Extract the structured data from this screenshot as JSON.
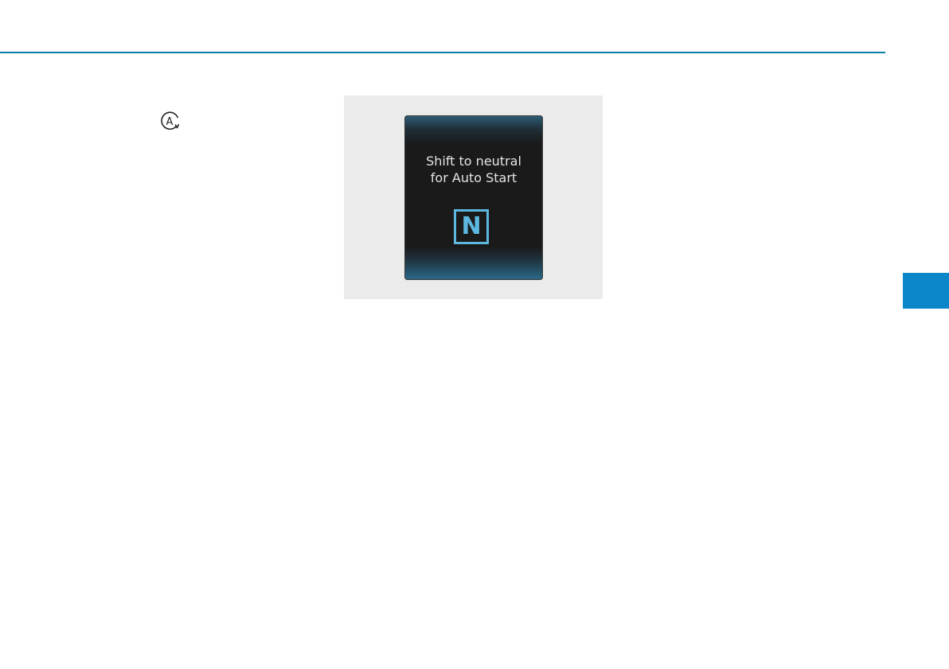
{
  "figure": {
    "display": {
      "message_line1": "Shift to neutral",
      "message_line2": "for Auto Start",
      "gear_indicator": "N"
    }
  },
  "icons": {
    "auto_stop": "auto-stop-indicator-icon"
  },
  "colors": {
    "accent": "#0a7fa8",
    "chapter_tab": "#0b86c8",
    "indicator": "#5cb8e0",
    "display_background": "#1a1a1a",
    "figure_background": "#ebebeb"
  }
}
